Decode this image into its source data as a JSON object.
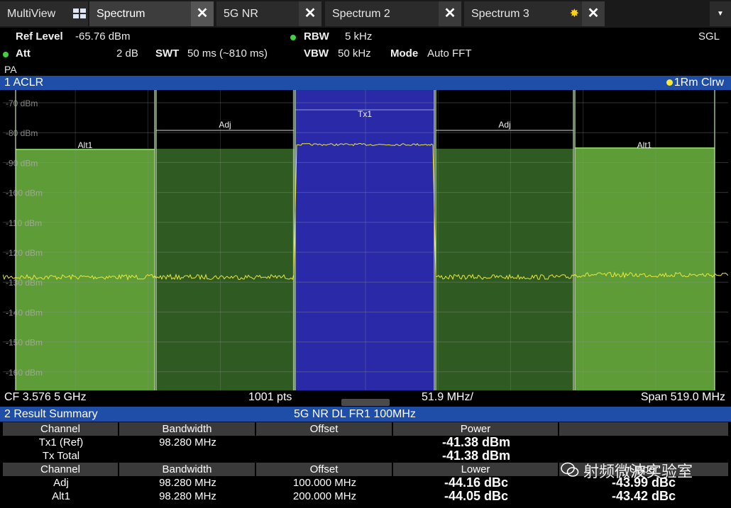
{
  "tabs": [
    {
      "label": "MultiView"
    },
    {
      "label": "Spectrum"
    },
    {
      "label": "5G NR"
    },
    {
      "label": "Spectrum 2"
    },
    {
      "label": "Spectrum 3"
    }
  ],
  "settings": {
    "ref_level_label": "Ref Level",
    "ref_level_value": "-65.76 dBm",
    "att_label": "Att",
    "att_value": "2 dB",
    "swt_label": "SWT",
    "swt_value": "50 ms (~810 ms)",
    "rbw_label": "RBW",
    "rbw_value": "5 kHz",
    "vbw_label": "VBW",
    "vbw_value": "50 kHz",
    "mode_label": "Mode",
    "mode_value": "Auto FFT",
    "sgl": "SGL",
    "pa": "PA"
  },
  "diagram": {
    "title": "1 ACLR",
    "trace": "1Rm Clrw",
    "y_ticks": [
      "-70 dBm",
      "-80 dBm",
      "-90 dBm",
      "-100 dBm",
      "-110 dBm",
      "-120 dBm",
      "-130 dBm",
      "-140 dBm",
      "-150 dBm",
      "-160 dBm"
    ],
    "channel_labels": [
      "Alt1",
      "Adj",
      "Tx1",
      "Adj",
      "Alt1"
    ],
    "colors": {
      "tx": "#2a2aa8",
      "adj": "#2f5b22",
      "alt": "#5e9c37",
      "trace": "#e8e83a"
    }
  },
  "axis": {
    "cf": "CF 3.576 5 GHz",
    "pts": "1001 pts",
    "div": "51.9 MHz/",
    "span": "Span 519.0 MHz"
  },
  "result_summary": {
    "title": "2 Result Summary",
    "standard": "5G NR DL FR1 100MHz",
    "header1": [
      "Channel",
      "Bandwidth",
      "Offset",
      "Power"
    ],
    "rows1": [
      {
        "channel": "Tx1 (Ref)",
        "bandwidth": "98.280 MHz",
        "power": "-41.38 dBm"
      },
      {
        "channel": "Tx Total",
        "bandwidth": "",
        "power": "-41.38 dBm"
      }
    ],
    "header2": [
      "Channel",
      "Bandwidth",
      "Offset",
      "Lower",
      "Upper"
    ],
    "rows2": [
      {
        "channel": "Adj",
        "bandwidth": "98.280 MHz",
        "offset": "100.000 MHz",
        "lower": "-44.16 dBc",
        "upper": "-43.99 dBc"
      },
      {
        "channel": "Alt1",
        "bandwidth": "98.280 MHz",
        "offset": "200.000 MHz",
        "lower": "-44.05 dBc",
        "upper": "-43.42 dBc"
      }
    ]
  },
  "watermark": "射频微波实验室"
}
